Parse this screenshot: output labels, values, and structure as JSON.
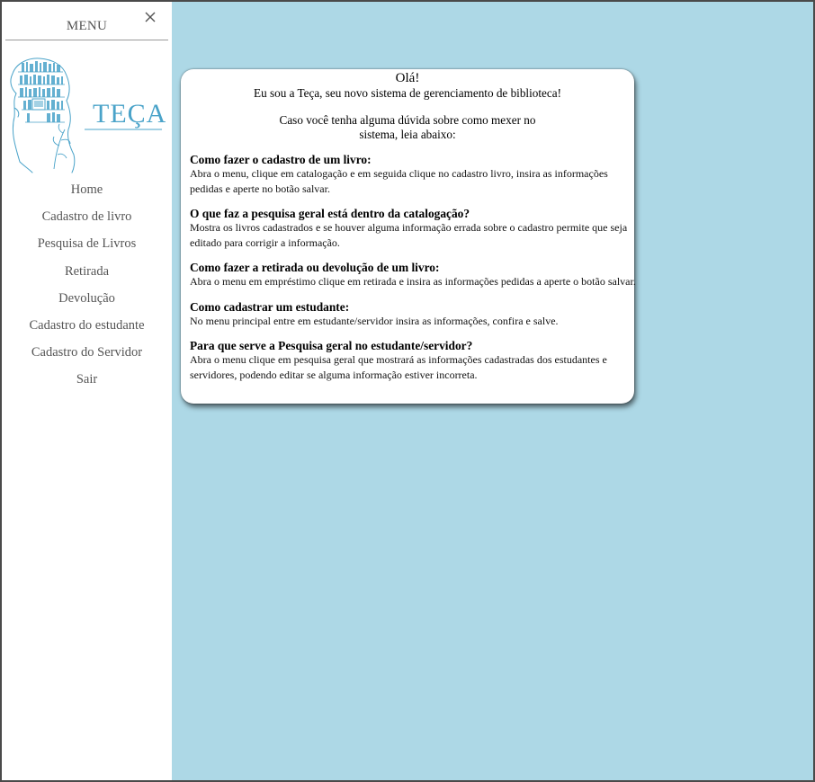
{
  "menu": {
    "title": "MENU",
    "close_icon": "close-icon",
    "logo_text": "TEÇA",
    "items": [
      {
        "label": "Home"
      },
      {
        "label": "Cadastro de livro"
      },
      {
        "label": "Pesquisa de Livros"
      },
      {
        "label": "Retirada"
      },
      {
        "label": "Devolução"
      },
      {
        "label": "Cadastro do estudante"
      },
      {
        "label": "Cadastro do Servidor"
      },
      {
        "label": "Sair"
      }
    ]
  },
  "colors": {
    "background": "#add8e6",
    "logo_accent": "#4aa3c9",
    "menu_text": "#555555"
  },
  "welcome": {
    "greeting": "Olá!",
    "intro": "Eu sou a Teça, seu novo sistema de gerenciamento de biblioteca!",
    "doubt": "Caso você tenha alguma dúvida sobre como mexer no sistema, leia abaixo:"
  },
  "faq": [
    {
      "question": "Como fazer o cadastro de um livro:",
      "answer": "Abra o menu, clique em catalogação e em seguida clique no cadastro livro, insira as informações pedidas e aperte no botão salvar."
    },
    {
      "question": "O que faz a pesquisa geral está dentro da catalogação?",
      "answer": "Mostra os livros cadastrados e se houver alguma informação errada sobre o cadastro permite que seja editado para corrigir a informação."
    },
    {
      "question": "Como fazer a retirada ou devolução de um livro:",
      "answer": "Abra o menu em empréstimo clique em retirada e insira as informações pedidas a aperte o botão salvar."
    },
    {
      "question": "Como cadastrar um estudante:",
      "answer": "No menu principal entre em estudante/servidor insira as informações, confira e salve."
    },
    {
      "question": "Para que serve a Pesquisa geral no estudante/servidor?",
      "answer": "Abra o menu clique em pesquisa geral que mostrará as informações cadastradas dos estudantes e servidores, podendo editar se alguma informação estiver incorreta."
    }
  ]
}
